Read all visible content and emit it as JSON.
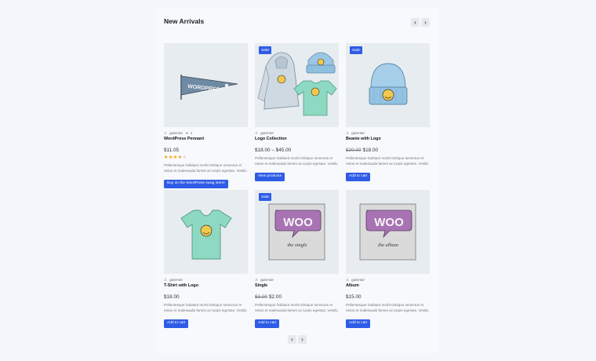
{
  "section": {
    "title": "New Arrivals"
  },
  "nav": {
    "prev": "‹",
    "next": "›"
  },
  "colors": {
    "accent": "#2f5ce6",
    "star": "#f0a000",
    "image_bg": "#e7ecf0"
  },
  "products": [
    {
      "sale_badge": "",
      "author": "gutentor",
      "comments": "1",
      "title": "WordPress Pennant",
      "price_old": "",
      "price": "$11.05",
      "rating": 4,
      "rating_max": 5,
      "description": [
        "Pellentesque habitant morbi tristique senectus et",
        "netus et malesuada fames ac turpis egestas. Vestib..."
      ],
      "button": "Buy on the WordPress swag store!",
      "image_icon": "pennant-image"
    },
    {
      "sale_badge": "Sale!",
      "author": "gutentor",
      "title": "Logo Collection",
      "price_old": "",
      "price": "$18.00 – $45.00",
      "description": [
        "Pellentesque habitant morbi tristique senectus et",
        "netus et malesuada fames ac turpis egestas. Vestib..."
      ],
      "button": "View products",
      "image_icon": "logo-collection-image"
    },
    {
      "sale_badge": "Sale!",
      "author": "gutentor",
      "title": "Beanie with Logo",
      "price_old": "$20.00",
      "price": "$18.00",
      "description": [
        "Pellentesque habitant morbi tristique senectus et",
        "netus et malesuada fames ac turpis egestas. Vestib..."
      ],
      "button": "Add to cart",
      "image_icon": "beanie-image"
    },
    {
      "sale_badge": "",
      "author": "gutentor",
      "title": "T-Shirt with Logo",
      "price_old": "",
      "price": "$18.00",
      "description": [
        "Pellentesque habitant morbi tristique senectus et",
        "netus et malesuada fames ac turpis egestas. Vestib..."
      ],
      "button": "Add to cart",
      "image_icon": "tshirt-image"
    },
    {
      "sale_badge": "Sale!",
      "author": "gutentor",
      "title": "Single",
      "price_old": "$3.00",
      "price": "$2.00",
      "description": [
        "Pellentesque habitant morbi tristique senectus et",
        "netus et malesuada fames ac turpis egestas. Vestib..."
      ],
      "button": "Add to cart",
      "image_icon": "woo-single-image",
      "image_text": {
        "logo": "WOO",
        "script": "the single"
      }
    },
    {
      "sale_badge": "",
      "author": "gutentor",
      "title": "Album",
      "price_old": "",
      "price": "$15.00",
      "description": [
        "Pellentesque habitant morbi tristique senectus et",
        "netus et malesuada fames ac turpis egestas. Vestib..."
      ],
      "button": "Add to cart",
      "image_icon": "woo-album-image",
      "image_text": {
        "logo": "WOO",
        "script": "the album"
      }
    }
  ]
}
